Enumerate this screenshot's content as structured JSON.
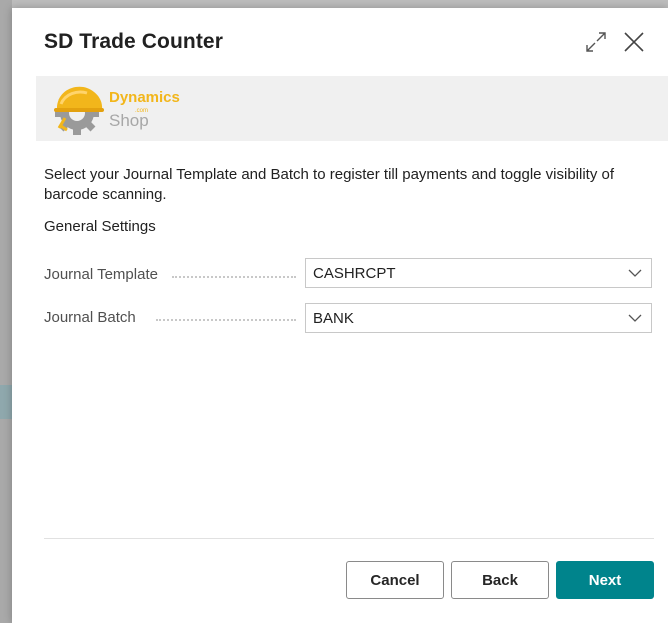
{
  "dialog": {
    "title": "SD Trade Counter"
  },
  "banner": {
    "logo_word1": "Dynamics",
    "logo_com": ".com",
    "logo_word2": "Shop"
  },
  "content": {
    "description": "Select your Journal Template and Batch to register till payments and toggle visibility of barcode scanning.",
    "section_label": "General Settings",
    "fields": [
      {
        "label": "Journal Template",
        "value": "CASHRCPT"
      },
      {
        "label": "Journal Batch",
        "value": "BANK"
      }
    ]
  },
  "footer": {
    "cancel_label": "Cancel",
    "back_label": "Back",
    "next_label": "Next"
  },
  "colors": {
    "accent": "#00848c",
    "logo_yellow": "#f2b61b",
    "logo_gray": "#a7a7a7",
    "banner_bg": "#f0f0f0"
  }
}
